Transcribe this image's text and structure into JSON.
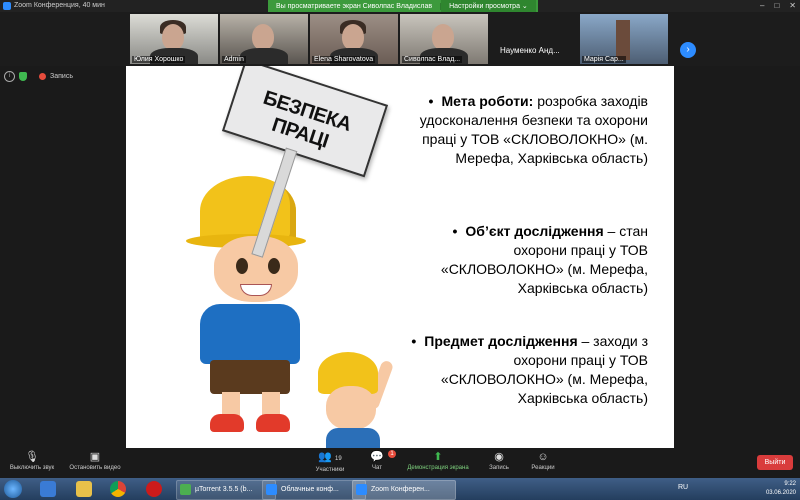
{
  "window": {
    "title": "Zoom Конференция, 40 мин"
  },
  "banner": {
    "viewing": "Вы просматриваете экран Сиволпас Владислав",
    "options": "Настройки просмотра ⌄"
  },
  "participants": [
    {
      "name": "Юлия Хорошко"
    },
    {
      "name": "Admin"
    },
    {
      "name": "Elena Sharovatova"
    },
    {
      "name": "Сиволпас Влад..."
    },
    {
      "name": "Науменко  Анд..."
    },
    {
      "name": "Марія Сар..."
    }
  ],
  "recording": {
    "label": "Запись"
  },
  "slide": {
    "sign_text": "БЕЗПЕКА ПРАЦІ",
    "p1_bold": "Мета роботи:",
    "p1_rest": " розробка заходів удосконалення безпеки та охорони праці у ТОВ «СКЛОВОЛОКНО» (м. Мерефа, Харківська область)",
    "p2_bold": "Об’єкт дослідження",
    "p2_rest": " – стан охорони праці у ТОВ «СКЛОВОЛОКНО» (м. Мерефа, Харківська область)",
    "p3_bold": "Предмет дослідження",
    "p3_rest": " – заходи з охорони праці у ТОВ «СКЛОВОЛОКНО» (м. Мерефа, Харківська область)"
  },
  "toolbar": {
    "mute": "Выключить звук",
    "video": "Остановить видео",
    "participants": "Участники",
    "participants_count": "19",
    "chat": "Чат",
    "chat_badge": "1",
    "share": "Демонстрация экрана",
    "record": "Запись",
    "reactions": "Реакции",
    "exit": "Выйти"
  },
  "taskbar": {
    "utorrent": "µTorrent 3.5.5 (b...",
    "cloud_conf": "Облачные конф...",
    "zoom_conf": "Zoom Конферен...",
    "lang": "RU",
    "time": "9:22",
    "date": "03.06.2020"
  }
}
